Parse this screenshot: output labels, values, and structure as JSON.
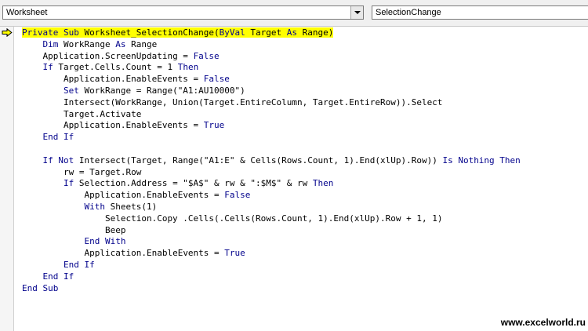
{
  "toolbar": {
    "object_combo": {
      "value": "Worksheet"
    },
    "procedure_combo": {
      "value": "SelectionChange"
    }
  },
  "editor": {
    "current_line_index": 0,
    "highlight_color": "#ffff00",
    "keyword_color": "#00008b",
    "lines": [
      {
        "indent": 0,
        "tokens": [
          [
            "kw",
            "Private Sub"
          ],
          [
            "t",
            " Worksheet_SelectionChange("
          ],
          [
            "kw",
            "ByVal"
          ],
          [
            "t",
            " Target "
          ],
          [
            "kw",
            "As"
          ],
          [
            "t",
            " Range)"
          ]
        ]
      },
      {
        "indent": 1,
        "tokens": [
          [
            "kw",
            "Dim"
          ],
          [
            "t",
            " WorkRange "
          ],
          [
            "kw",
            "As"
          ],
          [
            "t",
            " Range"
          ]
        ]
      },
      {
        "indent": 1,
        "tokens": [
          [
            "t",
            "Application.ScreenUpdating = "
          ],
          [
            "kw",
            "False"
          ]
        ]
      },
      {
        "indent": 1,
        "tokens": [
          [
            "kw",
            "If"
          ],
          [
            "t",
            " Target.Cells.Count = 1 "
          ],
          [
            "kw",
            "Then"
          ]
        ]
      },
      {
        "indent": 2,
        "tokens": [
          [
            "t",
            "Application.EnableEvents = "
          ],
          [
            "kw",
            "False"
          ]
        ]
      },
      {
        "indent": 2,
        "tokens": [
          [
            "kw",
            "Set"
          ],
          [
            "t",
            " WorkRange = Range(\"A1:AU10000\")"
          ]
        ]
      },
      {
        "indent": 2,
        "tokens": [
          [
            "t",
            "Intersect(WorkRange, Union(Target.EntireColumn, Target.EntireRow)).Select"
          ]
        ]
      },
      {
        "indent": 2,
        "tokens": [
          [
            "t",
            "Target.Activate"
          ]
        ]
      },
      {
        "indent": 2,
        "tokens": [
          [
            "t",
            "Application.EnableEvents = "
          ],
          [
            "kw",
            "True"
          ]
        ]
      },
      {
        "indent": 1,
        "tokens": [
          [
            "kw",
            "End If"
          ]
        ]
      },
      {
        "indent": 0,
        "tokens": []
      },
      {
        "indent": 1,
        "tokens": [
          [
            "kw",
            "If Not"
          ],
          [
            "t",
            " Intersect(Target, Range(\"A1:E\" & Cells(Rows.Count, 1).End(xlUp).Row)) "
          ],
          [
            "kw",
            "Is Nothing Then"
          ]
        ]
      },
      {
        "indent": 2,
        "tokens": [
          [
            "t",
            "rw = Target.Row"
          ]
        ]
      },
      {
        "indent": 2,
        "tokens": [
          [
            "kw",
            "If"
          ],
          [
            "t",
            " Selection.Address = \"$A$\" & rw & \":$M$\" & rw "
          ],
          [
            "kw",
            "Then"
          ]
        ]
      },
      {
        "indent": 3,
        "tokens": [
          [
            "t",
            "Application.EnableEvents = "
          ],
          [
            "kw",
            "False"
          ]
        ]
      },
      {
        "indent": 3,
        "tokens": [
          [
            "kw",
            "With"
          ],
          [
            "t",
            " Sheets(1)"
          ]
        ]
      },
      {
        "indent": 4,
        "tokens": [
          [
            "t",
            "Selection.Copy .Cells(.Cells(Rows.Count, 1).End(xlUp).Row + 1, 1)"
          ]
        ]
      },
      {
        "indent": 4,
        "tokens": [
          [
            "t",
            "Beep"
          ]
        ]
      },
      {
        "indent": 3,
        "tokens": [
          [
            "kw",
            "End With"
          ]
        ]
      },
      {
        "indent": 3,
        "tokens": [
          [
            "t",
            "Application.EnableEvents = "
          ],
          [
            "kw",
            "True"
          ]
        ]
      },
      {
        "indent": 2,
        "tokens": [
          [
            "kw",
            "End If"
          ]
        ]
      },
      {
        "indent": 1,
        "tokens": [
          [
            "kw",
            "End If"
          ]
        ]
      },
      {
        "indent": 0,
        "tokens": [
          [
            "kw",
            "End Sub"
          ]
        ]
      }
    ]
  },
  "watermark": {
    "text": "www.excelworld.ru"
  },
  "icons": {
    "execution_pointer": "arrow-right-icon"
  }
}
